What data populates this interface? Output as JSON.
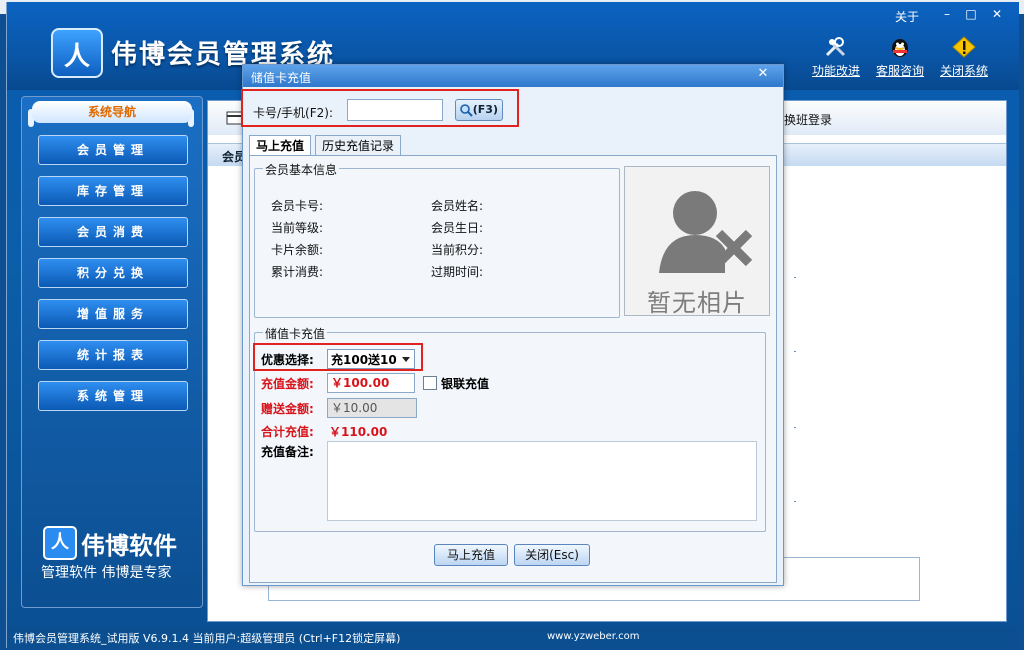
{
  "window": {
    "title": "伟博会员管理系统",
    "about": "关于",
    "minimize": "–",
    "maximize": "□",
    "close": "✕"
  },
  "toolbar": [
    {
      "label": "功能改进",
      "icon": "tools-icon"
    },
    {
      "label": "客服咨询",
      "icon": "qq-penguin-icon"
    },
    {
      "label": "关闭系统",
      "icon": "warning-icon"
    }
  ],
  "sidebar": {
    "title": "系统导航",
    "items": [
      "会员管理",
      "库存管理",
      "会员消费",
      "积分兑换",
      "增值服务",
      "统计报表",
      "系统管理"
    ]
  },
  "brand": {
    "name": "伟博软件",
    "tagline": "管理软件 伟博是专家"
  },
  "main": {
    "tab_label": "会员",
    "shift_login": "换班登录"
  },
  "status": {
    "text": "伟博会员管理系统_试用版 V6.9.1.4 当前用户:超级管理员 (Ctrl+F12锁定屏幕)",
    "url": "www.yzweber.com"
  },
  "dialog": {
    "title": "储值卡充值",
    "close": "✕",
    "card_label": "卡号/手机(F2):",
    "card_value": "",
    "card_button": "(F3)",
    "tabs": [
      "马上充值",
      "历史充值记录"
    ],
    "basic_info": {
      "title": "会员基本信息",
      "fields_left": [
        "会员卡号:",
        "当前等级:",
        "卡片余额:",
        "累计消费:"
      ],
      "fields_right": [
        "会员姓名:",
        "会员生日:",
        "当前积分:",
        "过期时间:"
      ],
      "photo_text": "暂无相片"
    },
    "recharge": {
      "title": "储值卡充值",
      "promo_label": "优惠选择:",
      "promo_value": "充100送10",
      "amount_label": "充值金额:",
      "amount_value": "￥100.00",
      "unionpay_label": "银联充值",
      "bonus_label": "赠送金额:",
      "bonus_value": "￥10.00",
      "total_label": "合计充值:",
      "total_value": "￥110.00",
      "remark_label": "充值备注:",
      "remark_value": ""
    },
    "buttons": {
      "recharge": "马上充值",
      "close": "关闭(Esc)"
    }
  }
}
